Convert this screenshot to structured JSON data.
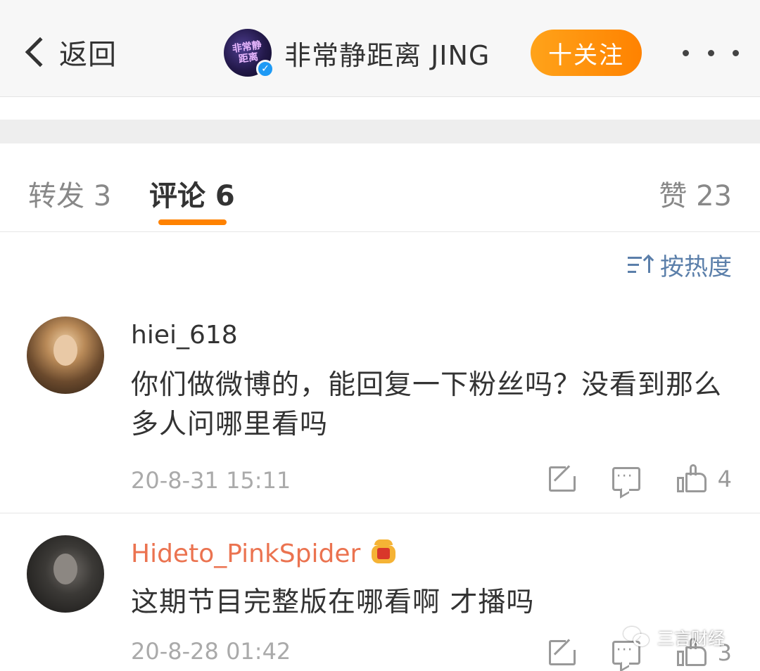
{
  "nav": {
    "back_label": "返回",
    "account_name": "非常静距离 JING",
    "account_avatar_text": "非常静距离",
    "verified_mark": "✓",
    "follow_label": "十关注"
  },
  "tabs": {
    "repost": "转发 3",
    "comment": "评论 6",
    "like": "赞 23"
  },
  "sort_label": "按热度",
  "comments": [
    {
      "username": "hiei_618",
      "text": "你们做微博的，能回复一下粉丝吗？没看到那么多人问哪里看吗",
      "time": "20-8-31 15:11",
      "likes": "4"
    },
    {
      "username": "Hideto_PinkSpider",
      "text": "这期节目完整版在哪看啊 才播吗",
      "time": "20-8-28 01:42",
      "likes": "3"
    }
  ],
  "watermark": "三言财经",
  "colors": {
    "accent_orange": "#ff8200",
    "vip_username": "#eb7350",
    "sort_blue": "#5b7faa",
    "verified_blue": "#1e9af5"
  },
  "icons": [
    "back-chevron-icon",
    "verified-icon",
    "more-icon",
    "sort-icon",
    "share-icon",
    "comment-icon",
    "like-icon",
    "crown-icon",
    "wechat-icon"
  ]
}
